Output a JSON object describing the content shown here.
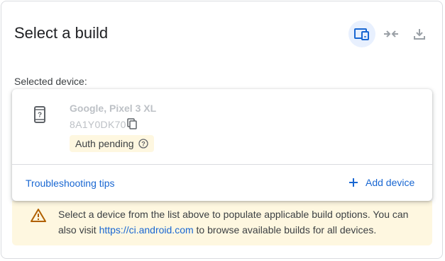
{
  "header": {
    "title": "Select a build",
    "icons": [
      "devices-icon",
      "connect-icon",
      "download-icon"
    ]
  },
  "device_section": {
    "label": "Selected device:",
    "device": {
      "name": "Google, Pixel 3 XL",
      "serial": "8A1Y0DK70",
      "status": "Auth pending"
    },
    "troubleshooting_label": "Troubleshooting tips",
    "add_device_label": "Add device"
  },
  "notice": {
    "text_before": "Select a device from the list above to populate applicable build options. You can also visit ",
    "link": "https://ci.android.com",
    "text_after": " to browse available builds for all devices."
  },
  "colors": {
    "accent": "#1967d2",
    "active_bg": "#e8f0fe",
    "warning_bg": "#fef7e0",
    "warning_icon": "#b06000"
  }
}
